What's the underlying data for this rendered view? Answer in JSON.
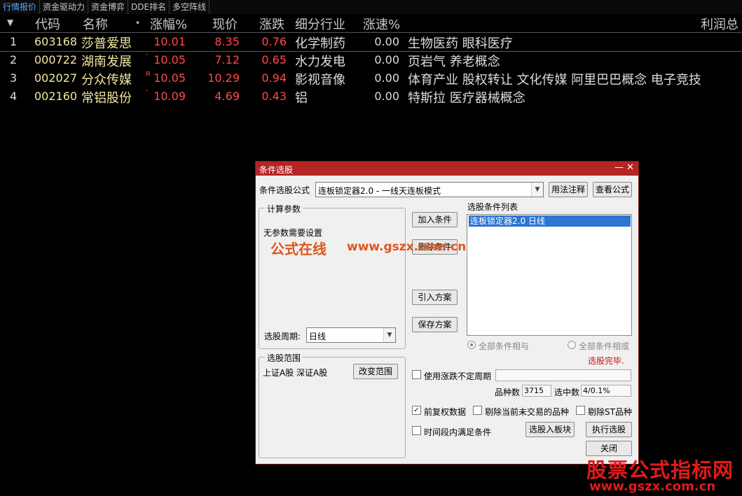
{
  "tabs": [
    "行情报价",
    "资金驱动力",
    "资金博弈",
    "DDE排名",
    "多空阵线"
  ],
  "table": {
    "headers": {
      "menu": "▼",
      "code": "代码",
      "name": "名称",
      "name_marker": "•",
      "pct": "涨幅%",
      "price": "现价",
      "chg": "涨跌",
      "industry": "细分行业",
      "speed": "涨速%",
      "right": "利润总"
    },
    "rows": [
      {
        "idx": "1",
        "code": "603168",
        "name": "莎普爱思",
        "flag": "",
        "pct": "10.01",
        "price": "8.35",
        "chg": "0.76",
        "industry": "化学制药",
        "speed": "0.00",
        "concept": "生物医药 眼科医疗"
      },
      {
        "idx": "2",
        "code": "000722",
        "name": "湖南发展",
        "flag": "'",
        "pct": "10.05",
        "price": "7.12",
        "chg": "0.65",
        "industry": "水力发电",
        "speed": "0.00",
        "concept": "页岩气 养老概念"
      },
      {
        "idx": "3",
        "code": "002027",
        "name": "分众传媒",
        "flag": "R",
        "pct": "10.05",
        "price": "10.29",
        "chg": "0.94",
        "industry": "影视音像",
        "speed": "0.00",
        "concept": "体育产业 股权转让 文化传媒 阿里巴巴概念 电子竞技"
      },
      {
        "idx": "4",
        "code": "002160",
        "name": "常铝股份",
        "flag": "'",
        "pct": "10.09",
        "price": "4.69",
        "chg": "0.43",
        "industry": "铝",
        "speed": "0.00",
        "concept": "特斯拉 医疗器械概念"
      }
    ]
  },
  "dialog": {
    "title": "条件选股",
    "min_glyph": "—",
    "close_glyph": "✕",
    "formula_label": "条件选股公式",
    "formula_value": "连板锁定器2.0 - 一线天连板模式",
    "usage_button": "用法注释",
    "view_button": "查看公式",
    "params_group": "计算参数",
    "params_text": "无参数需要设置",
    "period_label": "选股周期:",
    "period_value": "日线",
    "scope_group": "选股范围",
    "scope_text": "上证A股 深证A股",
    "change_scope_button": "改变范围",
    "add_condition_button": "加入条件",
    "delete_condition_button": "删除条件",
    "import_plan_button": "引入方案",
    "save_plan_button": "保存方案",
    "condition_list_label": "选股条件列表",
    "condition_item": "连板锁定器2.0  日线",
    "radio_and": "全部条件相与",
    "radio_or": "全部条件相或",
    "status": "选股完毕.",
    "use_period_label": "使用涨跌不定周期",
    "variety_label": "品种数",
    "variety_value": "3715",
    "hit_label": "选中数",
    "hit_value": "4/0.1%",
    "adjust_label": "前复权数据",
    "exclude_notrade_label": "剔除当前未交易的品种",
    "exclude_st_label": "剔除ST品种",
    "time_condition_label": "时间段内满足条件",
    "to_block_button": "选股入板块",
    "execute_button": "执行选股",
    "close_button": "关闭",
    "adjust_checked": true
  },
  "watermark": {
    "text1": "公式在线",
    "text2": "www.gszx.com.cn",
    "color": "#e0561c"
  },
  "brand": {
    "title": "股票公式指标网",
    "url": "www.gszx.com.cn",
    "color": "#e11a1a"
  },
  "colors": {
    "rise": "#ff4a4a",
    "code": "#f2e8a0",
    "selection": "#2d76d2",
    "titlebar": "#b42525"
  }
}
